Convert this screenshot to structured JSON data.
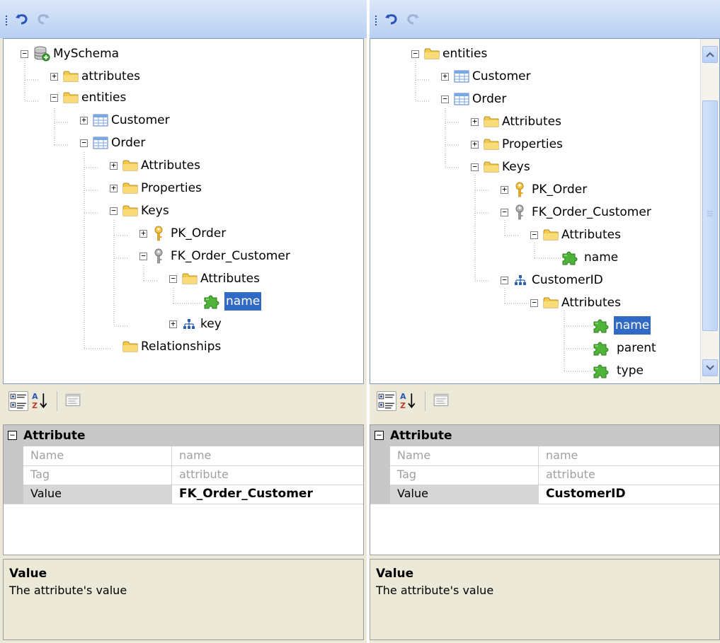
{
  "left_pane": {
    "toolbar": {
      "undo_icon": "undo-icon",
      "redo_icon": "redo-icon"
    },
    "tree": {
      "root": "MySchema",
      "attributes_folder": "attributes",
      "entities_folder": "entities",
      "customer": "Customer",
      "order": "Order",
      "order_attributes": "Attributes",
      "order_properties": "Properties",
      "order_keys": "Keys",
      "pk_order": "PK_Order",
      "fk_order_customer": "FK_Order_Customer",
      "fk_attributes": "Attributes",
      "fk_attr_name": "name",
      "key": "key",
      "relationships": "Relationships"
    },
    "properties": {
      "category": "Attribute",
      "rows": [
        {
          "name": "Name",
          "value": "name"
        },
        {
          "name": "Tag",
          "value": "attribute"
        },
        {
          "name": "Value",
          "value": "FK_Order_Customer"
        }
      ]
    },
    "help": {
      "title": "Value",
      "description": "The attribute's value"
    }
  },
  "right_pane": {
    "toolbar": {
      "undo_icon": "undo-icon",
      "redo_icon": "redo-icon"
    },
    "tree": {
      "entities_folder": "entities",
      "customer": "Customer",
      "order": "Order",
      "order_attributes": "Attributes",
      "order_properties": "Properties",
      "order_keys": "Keys",
      "pk_order": "PK_Order",
      "fk_order_customer": "FK_Order_Customer",
      "fk_attributes": "Attributes",
      "fk_attr_name": "name",
      "customer_id": "CustomerID",
      "cid_attributes": "Attributes",
      "cid_name": "name",
      "cid_parent": "parent",
      "cid_type": "type"
    },
    "properties": {
      "category": "Attribute",
      "rows": [
        {
          "name": "Name",
          "value": "name"
        },
        {
          "name": "Tag",
          "value": "attribute"
        },
        {
          "name": "Value",
          "value": "CustomerID"
        }
      ]
    },
    "help": {
      "title": "Value",
      "description": "The attribute's value"
    }
  },
  "colors": {
    "selection": "#316ac5",
    "toolbar_top": "#dbe7f9",
    "toolbar_bottom": "#b9d0f3",
    "panel": "#ece9d8"
  }
}
